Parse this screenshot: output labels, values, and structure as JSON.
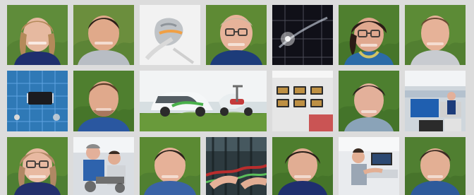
{
  "gallery": {
    "tiles": [
      {
        "kind": "portrait",
        "subject": "woman",
        "bg": "#5f8c3a",
        "skin": "#e6b9a0",
        "hair": "#b48a5a",
        "shirt": "#1f2f6e",
        "glasses": false
      },
      {
        "kind": "portrait",
        "subject": "man",
        "bg": "#6b8e3d",
        "skin": "#e0a98a",
        "hair": "#2a1f17",
        "shirt": "#b8bdc4",
        "glasses": false
      },
      {
        "kind": "object",
        "subject": "tool-on-white",
        "bg": "#e9e9ea"
      },
      {
        "kind": "portrait",
        "subject": "man",
        "bg": "#5e8a34",
        "skin": "#e7b39a",
        "hair": "#c9b7a0",
        "shirt": "#1d3c7a",
        "glasses": true
      },
      {
        "kind": "object",
        "subject": "solar-panel",
        "bg": "#101018"
      },
      {
        "kind": "portrait",
        "subject": "woman",
        "bg": "#4f7f2f",
        "skin": "#e0a88f",
        "hair": "#2b1b16",
        "shirt": "#2b6ba8",
        "glasses": true
      },
      {
        "kind": "portrait",
        "subject": "man",
        "bg": "#5c8b36",
        "skin": "#e6b298",
        "hair": "#6b4a34",
        "shirt": "#c8cbd0",
        "glasses": false
      },
      {
        "kind": "object",
        "subject": "circuit-board",
        "bg": "#2f79b6"
      },
      {
        "kind": "portrait",
        "subject": "man",
        "bg": "#4f7f2f",
        "skin": "#e0a98c",
        "hair": "#5a3c28",
        "shirt": "#2a57a0",
        "glasses": false
      },
      {
        "kind": "scene",
        "subject": "car-and-scooter",
        "bg": "#d7dfe2"
      },
      {
        "kind": "object",
        "subject": "monitors-on-wall",
        "bg": "#e6e6e6"
      },
      {
        "kind": "portrait",
        "subject": "man",
        "bg": "#4d7f2f",
        "skin": "#e3b09a",
        "hair": "#2e2420",
        "shirt": "#8aa3b8",
        "glasses": false
      },
      {
        "kind": "scene",
        "subject": "workshop",
        "bg": "#cfd6dc"
      },
      {
        "kind": "portrait",
        "subject": "woman",
        "bg": "#5a8a35",
        "skin": "#e8b9a1",
        "hair": "#b08864",
        "shirt": "#23306c",
        "glasses": true
      },
      {
        "kind": "scene",
        "subject": "workers",
        "bg": "#d9dde2"
      },
      {
        "kind": "portrait",
        "subject": "man",
        "bg": "#5b8a33",
        "skin": "#e6b198",
        "hair": "#2c221b",
        "shirt": "#3a63a6",
        "glasses": false
      },
      {
        "kind": "scene",
        "subject": "hands-with-cables",
        "bg": "#2d3a3f"
      },
      {
        "kind": "portrait",
        "subject": "man",
        "bg": "#4e7e2e",
        "skin": "#e1ad93",
        "hair": "#2a201a",
        "shirt": "#1f2f6e",
        "glasses": false
      },
      {
        "kind": "scene",
        "subject": "lab-worker",
        "bg": "#e9ebee"
      },
      {
        "kind": "portrait",
        "subject": "man",
        "bg": "#507f31",
        "skin": "#e3af94",
        "hair": "#3a2b22",
        "shirt": "#2e5a9b",
        "glasses": false
      }
    ]
  }
}
